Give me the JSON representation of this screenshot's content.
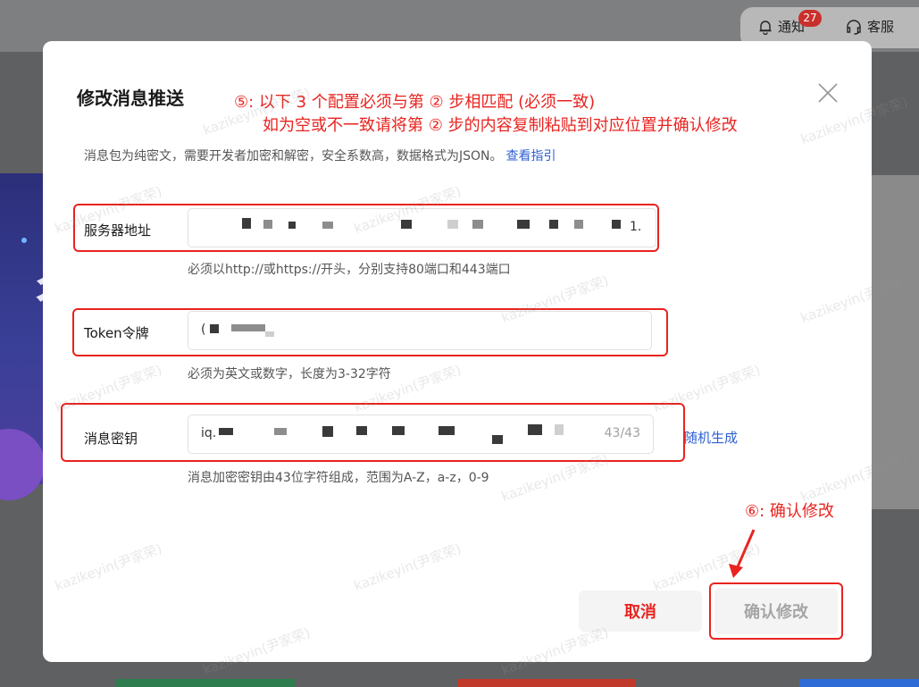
{
  "header": {
    "notify_label": "通知",
    "notify_count": "27",
    "service_label": "客服"
  },
  "background": {
    "banner_char": "彳"
  },
  "modal": {
    "title": "修改消息推送",
    "step5_line1": "⑤: 以下 3 个配置必须与第 ② 步相匹配 (必须一致)",
    "step5_line2": "如为空或不一致请将第 ② 步的内容复制粘贴到对应位置并确认修改",
    "description": "消息包为纯密文，需要开发者加密和解密，安全系数高，数据格式为JSON。",
    "guide_link": "查看指引",
    "fields": {
      "server": {
        "label": "服务器地址",
        "value_tail": "1.",
        "hint": "必须以http://或https://开头，分别支持80端口和443端口"
      },
      "token": {
        "label": "Token令牌",
        "value_head": "(",
        "hint": "必须为英文或数字，长度为3-32字符"
      },
      "aeskey": {
        "label": "消息密钥",
        "value_head": "iq.",
        "counter": "43/43",
        "hint": "消息加密密钥由43位字符组成，范围为A-Z，a-z，0-9",
        "random_label": "随机生成"
      }
    },
    "cancel_label": "取消",
    "confirm_label": "确认修改",
    "step6_note": "⑥: 确认修改"
  },
  "watermark": "kazikeyin(尹家荣)",
  "colors": {
    "annotation_red": "#e8231f",
    "link_blue": "#2f5fd3"
  }
}
